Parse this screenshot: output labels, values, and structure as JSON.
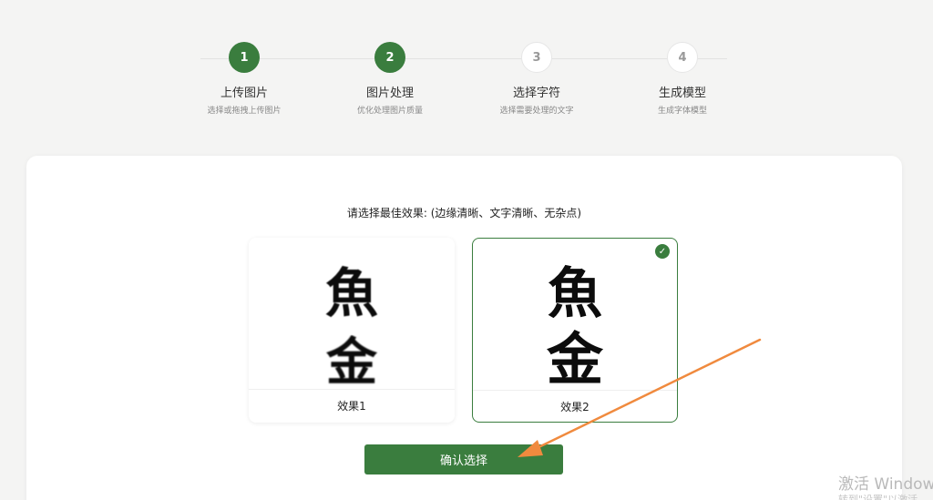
{
  "steps": [
    {
      "number": "1",
      "title": "上传图片",
      "subtitle": "选择或拖拽上传图片",
      "state": "done"
    },
    {
      "number": "2",
      "title": "图片处理",
      "subtitle": "优化处理图片质量",
      "state": "done"
    },
    {
      "number": "3",
      "title": "选择字符",
      "subtitle": "选择需要处理的文字",
      "state": "todo"
    },
    {
      "number": "4",
      "title": "生成模型",
      "subtitle": "生成字体模型",
      "state": "todo"
    }
  ],
  "selection": {
    "prompt": "请选择最佳效果: (边缘清晰、文字清晰、无杂点)",
    "options": [
      {
        "label": "效果1",
        "glyph_top": "魚",
        "glyph_bottom": "金",
        "selected": false
      },
      {
        "label": "效果2",
        "glyph_top": "魚",
        "glyph_bottom": "金",
        "selected": true
      }
    ],
    "confirm_label": "确认选择"
  },
  "colors": {
    "accent": "#3a7d3e",
    "annotation_arrow": "#f08a3e"
  },
  "watermark": {
    "line1": "激活 Window",
    "line2": "转到\"设置\"以激活"
  }
}
